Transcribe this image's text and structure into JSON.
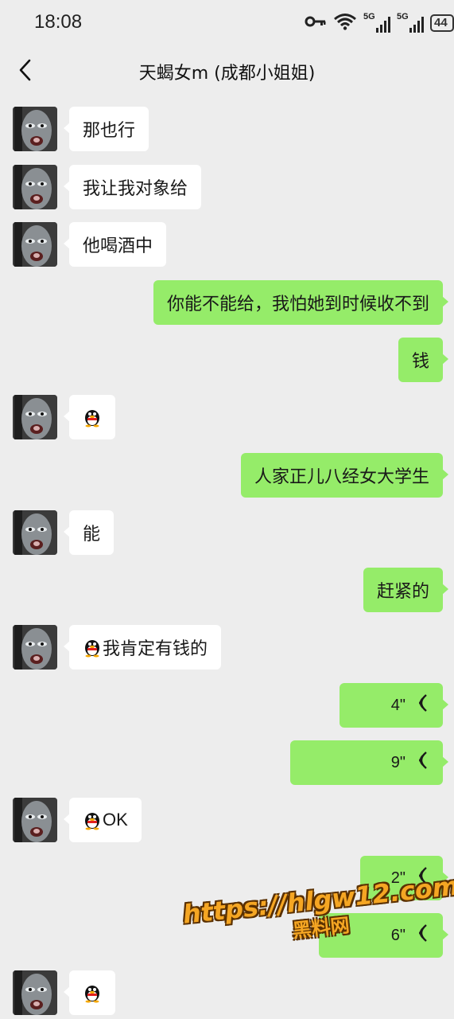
{
  "status_bar": {
    "time": "18:08",
    "signal1_label": "5G",
    "signal2_label": "5G",
    "battery": "44",
    "icons": [
      "key-icon",
      "wifi-icon",
      "signal-icon",
      "signal-icon",
      "battery-icon"
    ]
  },
  "header": {
    "back_icon": "chevron-left-icon",
    "title": "天蝎女m (成都小姐姐)"
  },
  "colors": {
    "background": "#ededed",
    "incoming_bubble": "#ffffff",
    "outgoing_bubble": "#95ec69",
    "watermark": "#f5a623"
  },
  "messages": [
    {
      "side": "in",
      "type": "text",
      "text": "那也行"
    },
    {
      "side": "in",
      "type": "text",
      "text": "我让我对象给"
    },
    {
      "side": "in",
      "type": "text",
      "text": "他喝酒中"
    },
    {
      "side": "out",
      "type": "text",
      "text": "你能不能给，我怕她到时候收不到"
    },
    {
      "side": "out",
      "type": "text",
      "text": "钱"
    },
    {
      "side": "in",
      "type": "emoji",
      "emoji": "qq-penguin-icon"
    },
    {
      "side": "out",
      "type": "text",
      "text": "人家正儿八经女大学生"
    },
    {
      "side": "in",
      "type": "text",
      "text": "能"
    },
    {
      "side": "out",
      "type": "text",
      "text": "赶紧的"
    },
    {
      "side": "in",
      "type": "emoji_text",
      "emoji": "qq-penguin-icon",
      "text": "我肯定有钱的"
    },
    {
      "side": "out",
      "type": "voice",
      "duration": "4\""
    },
    {
      "side": "out",
      "type": "voice",
      "duration": "9\""
    },
    {
      "side": "in",
      "type": "emoji_text",
      "emoji": "qq-penguin-icon",
      "text": "OK"
    },
    {
      "side": "out",
      "type": "voice",
      "duration": "2\""
    },
    {
      "side": "out",
      "type": "voice",
      "duration": "6\""
    },
    {
      "side": "in",
      "type": "emoji",
      "emoji": "qq-penguin-icon"
    }
  ],
  "watermark": {
    "line1": "https://hlgw12.com",
    "line2": "黑料网"
  }
}
